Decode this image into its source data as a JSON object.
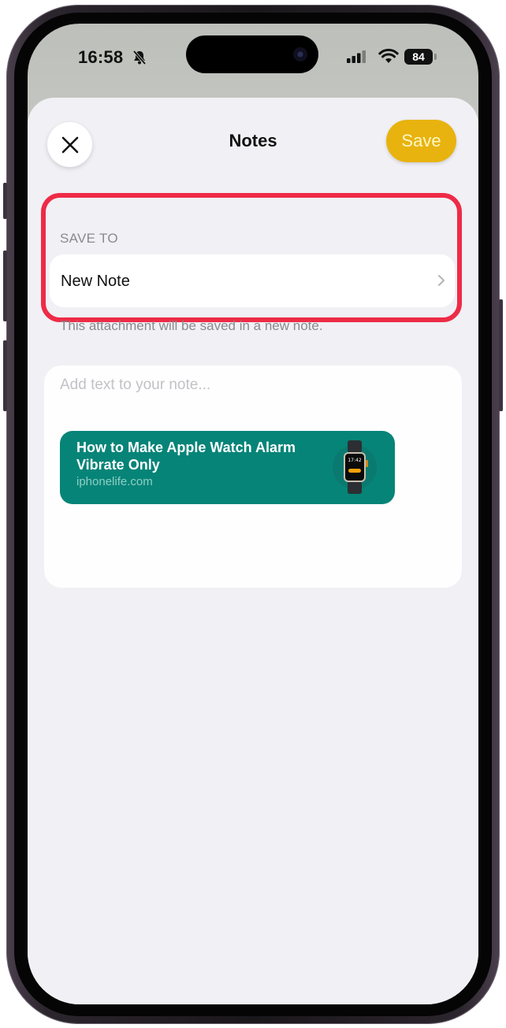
{
  "status_bar": {
    "time": "16:58",
    "battery": "84"
  },
  "header": {
    "title": "Notes",
    "save_label": "Save"
  },
  "save_to": {
    "section_label": "SAVE TO",
    "destination": "New Note",
    "footer": "This attachment will be saved in a new note."
  },
  "note": {
    "placeholder": "Add text to your note...",
    "link": {
      "title": "How to Make Apple Watch Alarm Vibrate Only",
      "domain": "iphonelife.com"
    }
  },
  "watch_thumb": {
    "time": "17:42"
  },
  "colors": {
    "accent": "#e8b30f",
    "highlight": "#ee2b47",
    "link_card": "#068478"
  }
}
